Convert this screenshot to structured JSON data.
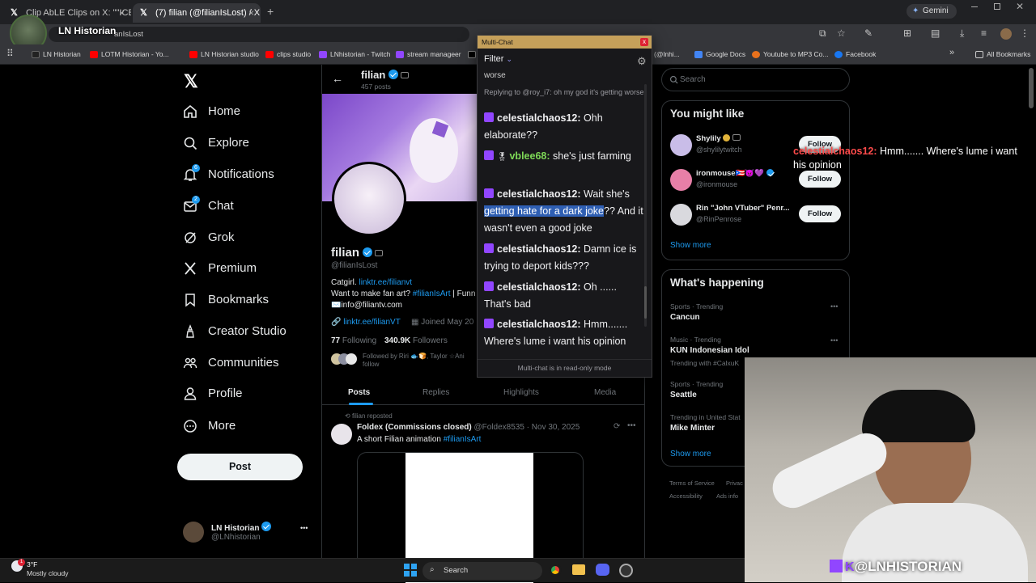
{
  "tabs": [
    {
      "title": "Clip AbLE Clips on X: \"\"ICE did i",
      "close": "×"
    },
    {
      "title": "(7) filian (@filianIsLost) / X",
      "close": "×"
    }
  ],
  "tab_new": "+",
  "gemini_label": "Gemini",
  "streamer_overlay_name": "LN Historian",
  "omnibox_text": "anIsLost",
  "bookmarks": [
    "LN Historian",
    "LOTM Historian - Yo...",
    "LN Historian studio",
    "clips studio",
    "LNhistorian - Twitch",
    "stream manageer",
    "(@lnhi...",
    "Google Docs",
    "Youtube to MP3 Co...",
    "Facebook"
  ],
  "all_bookmarks": "All Bookmarks",
  "nav": [
    {
      "label": "Home",
      "icon": "home-icon"
    },
    {
      "label": "Explore",
      "icon": "search-icon"
    },
    {
      "label": "Notifications",
      "icon": "bell-icon",
      "badge": "6"
    },
    {
      "label": "Chat",
      "icon": "mail-icon",
      "badge": "2"
    },
    {
      "label": "Grok",
      "icon": "grok-icon"
    },
    {
      "label": "Premium",
      "icon": "x-logo-icon"
    },
    {
      "label": "Bookmarks",
      "icon": "bookmark-icon"
    },
    {
      "label": "Creator Studio",
      "icon": "creator-studio-icon"
    },
    {
      "label": "Communities",
      "icon": "communities-icon"
    },
    {
      "label": "Profile",
      "icon": "person-icon"
    },
    {
      "label": "More",
      "icon": "more-circle-icon"
    }
  ],
  "post_button": "Post",
  "account": {
    "name": "LN Historian",
    "handle": "@LNhistorian",
    "more": "•••"
  },
  "profile": {
    "header_name": "filian",
    "header_posts": "457 posts",
    "name": "filian",
    "handle": "@filianIsLost",
    "bio1_a": "Catgirl.",
    "bio1_link": "linktr.ee/filianvt",
    "bio2_a": "Want to make fan art?",
    "bio2_tag": "#filianIsArt",
    "bio2_b": "| Funn",
    "bio3": "✉️info@filiantv.com",
    "website": "linktr.ee/filianVT",
    "joined": "Joined May 20",
    "following_num": "77",
    "following_label": "Following",
    "followers_num": "340.9K",
    "followers_label": "Followers",
    "followed_by": "Followed by Riri 🐟🍞, Taylor ☆Ani",
    "followed_by_2": "follow"
  },
  "profile_tabs": [
    "Posts",
    "Replies",
    "Highlights",
    "Media"
  ],
  "tweet": {
    "reposted": "filian reposted",
    "author": "Foldex (Commissions closed)",
    "handle_date": "@Foldex8535 · Nov 30, 2025",
    "text": "A short Filian animation",
    "tag": "#filianIsArt"
  },
  "multichat": {
    "title": "Multi-Chat",
    "close": "x",
    "filter": "Filter",
    "partial": "worse",
    "reply_context": "Replying to @roy_i7: oh my god it's getting worse",
    "messages": [
      {
        "user": "celestialchaos12:",
        "text": " Ohh elaborate??",
        "color": "#efeff1"
      },
      {
        "user": "vblee68:",
        "text": " she's just farming",
        "color": "#7ed957"
      },
      {
        "user": "celestialchaos12:",
        "text_a": " Wait she's ",
        "text_hl": "getting hate for a dark joke",
        "text_b": "?? And it wasn't even a good joke",
        "color": "#efeff1"
      },
      {
        "user": "celestialchaos12:",
        "text": " Damn ice is trying to deport kids???",
        "color": "#efeff1"
      },
      {
        "user": "celestialchaos12:",
        "text": " Oh ...... That's bad",
        "color": "#efeff1"
      },
      {
        "user": "celestialchaos12:",
        "text": " Hmm....... Where's lume i want his opinion",
        "color": "#efeff1"
      }
    ],
    "footer": "Multi-chat is in read-only mode"
  },
  "search_placeholder": "Search",
  "you_might_like": {
    "title": "You might like",
    "users": [
      {
        "name": "Shylily",
        "handle": "@shylilytwitch",
        "button": "Follow"
      },
      {
        "name": "ironmouse🇵🇷😈💜",
        "handle": "@ironmouse",
        "button": "Follow"
      },
      {
        "name": "Rin \"John VTuber\" Penr...",
        "handle": "@RinPenrose",
        "button": "Follow"
      }
    ],
    "show_more": "Show more"
  },
  "whats_happening": {
    "title": "What's happening",
    "trends": [
      {
        "sub": "Sports · Trending",
        "title": "Cancun"
      },
      {
        "sub": "Music · Trending",
        "title": "KUN Indonesian Idol",
        "extra": "Trending with #CalxuK"
      },
      {
        "sub": "Sports · Trending",
        "title": "Seattle"
      },
      {
        "sub": "Trending in United Stat",
        "title": "Mike Minter"
      }
    ],
    "show_more": "Show more"
  },
  "footer_links": [
    "Terms of Service",
    "Privac",
    "Accessibility",
    "Ads info"
  ],
  "overlay_chat": {
    "user": "celestialchaos12:",
    "text": " Hmm....... Where's lume i want his opinion"
  },
  "overlay_handle": "@LNHISTORIAN",
  "weather": {
    "temp": "3°F",
    "desc": "Mostly cloudy",
    "badge": "1"
  },
  "taskbar_search": "Search"
}
